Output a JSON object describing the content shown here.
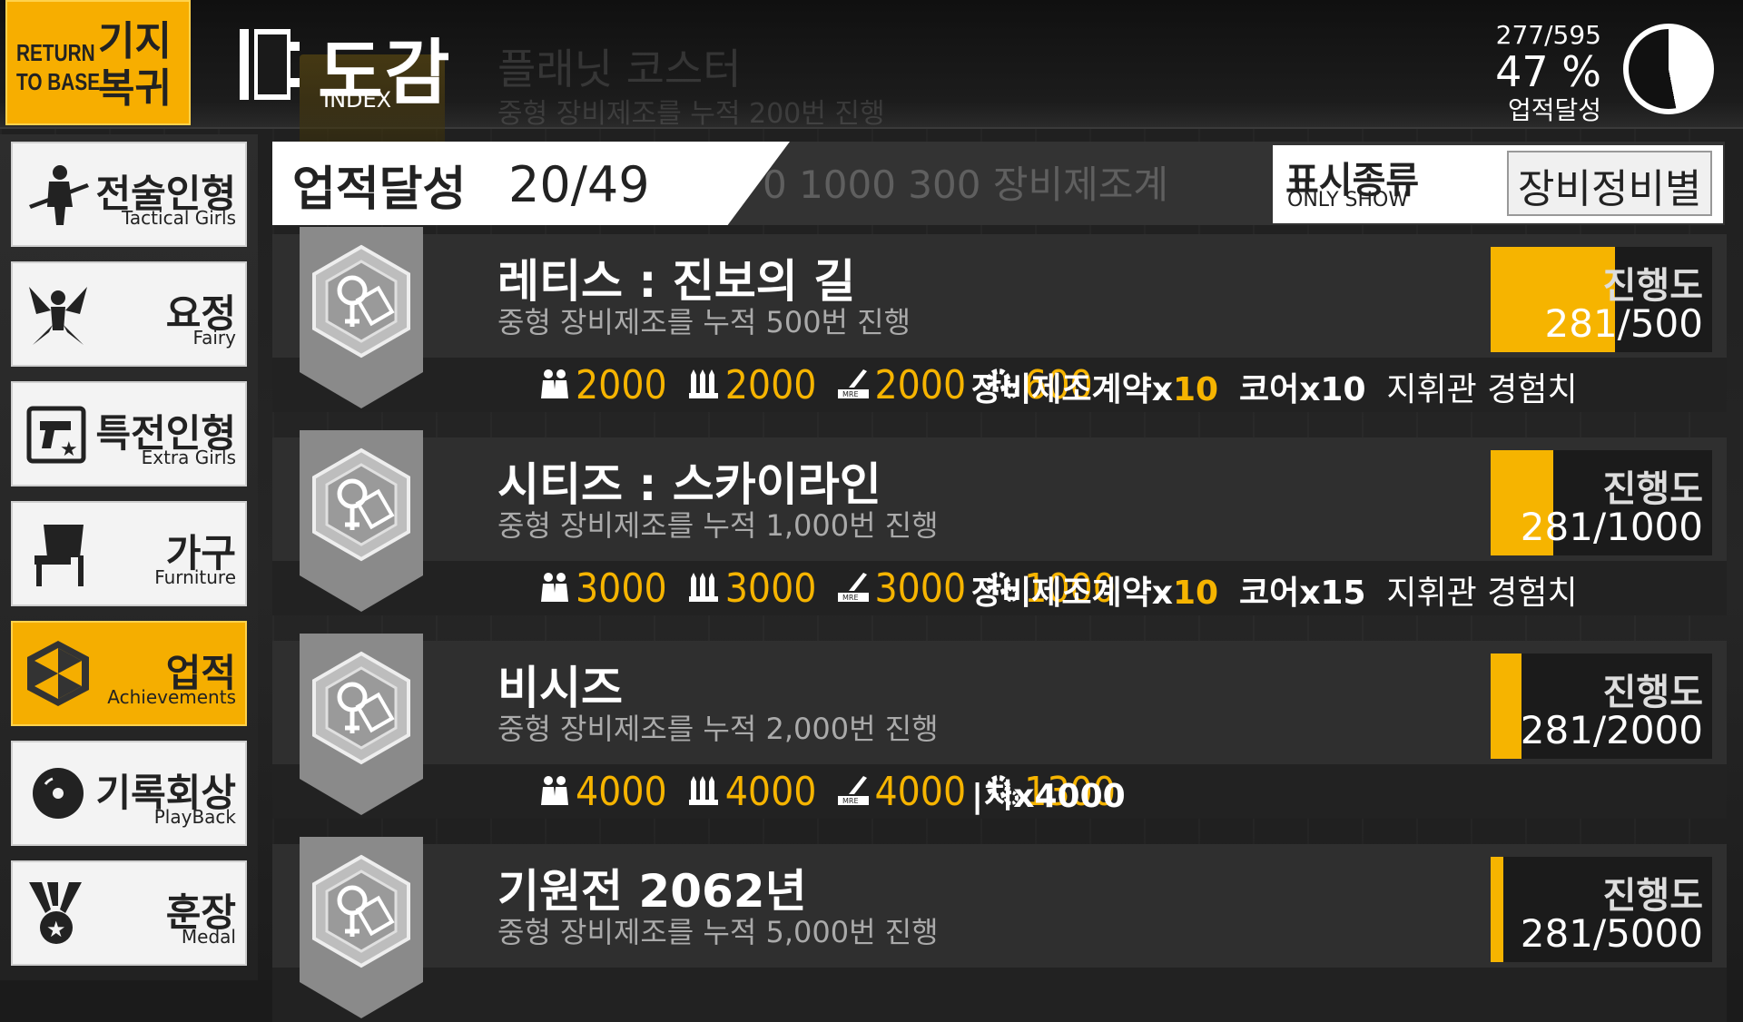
{
  "header": {
    "return_en": "RETURN TO BASE",
    "return_ko": "기지 복귀",
    "title": "도감",
    "subtitle": "INDEX",
    "bg_title": "플래닛 코스터",
    "bg_desc": "중형 장비제조를 누적 200번 진행",
    "total_count": "277/595",
    "total_percent": "47 %",
    "total_label": "업적달성",
    "total_fraction": 0.47
  },
  "sidebar": {
    "items": [
      {
        "ko": "전술인형",
        "en": "Tactical Girls",
        "icon": "rifle-soldier-icon",
        "active": false
      },
      {
        "ko": "요정",
        "en": "Fairy",
        "icon": "fairy-icon",
        "active": false
      },
      {
        "ko": "특전인형",
        "en": "Extra Girls",
        "icon": "pistol-star-icon",
        "active": false
      },
      {
        "ko": "가구",
        "en": "Furniture",
        "icon": "chair-icon",
        "active": false
      },
      {
        "ko": "업적",
        "en": "Achievements",
        "icon": "achievement-hex-icon",
        "active": true
      },
      {
        "ko": "기록회상",
        "en": "PlayBack",
        "icon": "disc-icon",
        "active": false
      },
      {
        "ko": "훈장",
        "en": "Medal",
        "icon": "medal-icon",
        "active": false
      }
    ]
  },
  "summary": {
    "label": "업적달성",
    "count": "20/49",
    "ghost": "0  1000  300  장비제조계"
  },
  "filter": {
    "label_ko": "표시종류",
    "label_en": "ONLY SHOW",
    "value": "장비정비별"
  },
  "achievements": [
    {
      "title": "레티스 : 진보의 길",
      "desc": "중형 장비제조를 누적 500번 진행",
      "progress_label": "진행도",
      "progress_text": "281/500",
      "progress": 0.562,
      "rewards": [
        "2000",
        "2000",
        "2000",
        "600"
      ],
      "items": {
        "a": "장비제조계약x",
        "a_n": "10",
        "b": "코어x10",
        "c": "지휘관 경험치"
      }
    },
    {
      "title": "시티즈 : 스카이라인",
      "desc": "중형 장비제조를 누적 1,000번 진행",
      "progress_label": "진행도",
      "progress_text": "281/1000",
      "progress": 0.281,
      "rewards": [
        "3000",
        "3000",
        "3000",
        "1000"
      ],
      "items": {
        "a": "장비제조계약x",
        "a_n": "10",
        "b": "코어x15",
        "c": "지휘관 경험치"
      }
    },
    {
      "title": "비시즈",
      "desc": "중형 장비제조를 누적 2,000번 진행",
      "progress_label": "진행도",
      "progress_text": "281/2000",
      "progress": 0.1405,
      "rewards": [
        "4000",
        "4000",
        "4000",
        "1300"
      ],
      "items": {
        "a": "|치x4000",
        "a_n": "",
        "b": "",
        "c": ""
      }
    },
    {
      "title": "기원전 2062년",
      "desc": "중형 장비제조를 누적 5,000번 진행",
      "progress_label": "진행도",
      "progress_text": "281/5000",
      "progress": 0.0562,
      "rewards": [],
      "items": {
        "a": "",
        "a_n": "",
        "b": "",
        "c": ""
      }
    }
  ],
  "colors": {
    "accent": "#f6b400",
    "panel": "#2f2f2f"
  }
}
